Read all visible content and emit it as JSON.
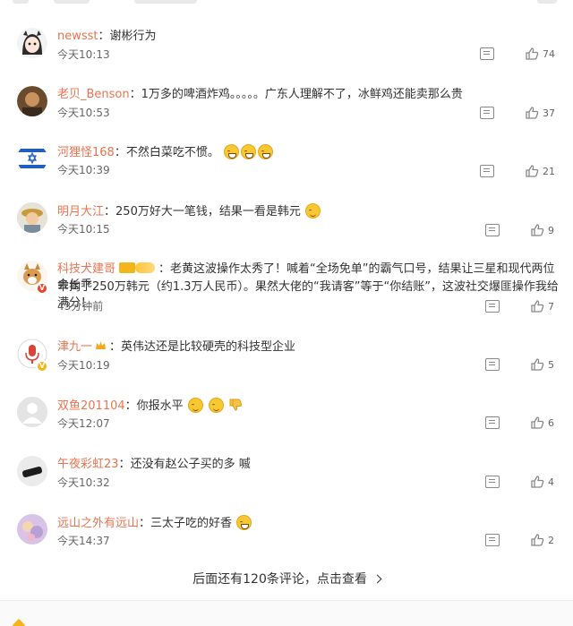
{
  "comments": [
    {
      "user": "newsst",
      "sep": "：",
      "text": "谢彬行为",
      "time": "今天10:13",
      "likes": "74"
    },
    {
      "user": "老贝_Benson",
      "sep": "：",
      "text": "1万多的啤酒炸鸡。。。。。广东人理解不了，冰鲜鸡还能卖那么贵",
      "time": "今天10:53",
      "likes": "37"
    },
    {
      "user": "河狸怪168",
      "sep": "：",
      "text": "不然白菜吃不惯。",
      "time": "今天10:39",
      "likes": "21"
    },
    {
      "user": "明月大江",
      "sep": "：",
      "text": "250万好大一笔钱，结果一看是韩元",
      "time": "今天10:15",
      "likes": "9"
    },
    {
      "user": "科技犬建哥",
      "sep": "：",
      "text_line1": "老黄这波操作太秀了！喊着“全场免单”的霸气口号，结果让三星和现代两位会长乖",
      "text_line2": "乖掏了250万韩元（约1.3万人民币）。果然大佬的“我请客”等于“你结账”，这波社交爆匪操作我给满分！",
      "time": "43分钟前",
      "likes": "7"
    },
    {
      "user": "津九一",
      "sep": "：",
      "text": "英伟达还是比较硬壳的科技型企业",
      "time": "今天10:19",
      "likes": "5"
    },
    {
      "user": "双鱼201104",
      "sep": "：",
      "text": "你报水平",
      "time": "今天12:07",
      "likes": "6"
    },
    {
      "user": "午夜彩虹23",
      "sep": "：",
      "text": "还没有赵公子买的多 嘁",
      "time": "今天10:32",
      "likes": "4"
    },
    {
      "user": "远山之外有远山",
      "sep": "：",
      "text": "三太子吃的好香",
      "time": "今天14:37",
      "likes": "2"
    }
  ],
  "more_label": "后面还有120条评论，点击查看",
  "icons": {
    "reply": "comment-icon",
    "like": "thumbs-up-icon"
  },
  "colors": {
    "username": "#eb7350",
    "text": "#333333",
    "meta": "#666666"
  }
}
